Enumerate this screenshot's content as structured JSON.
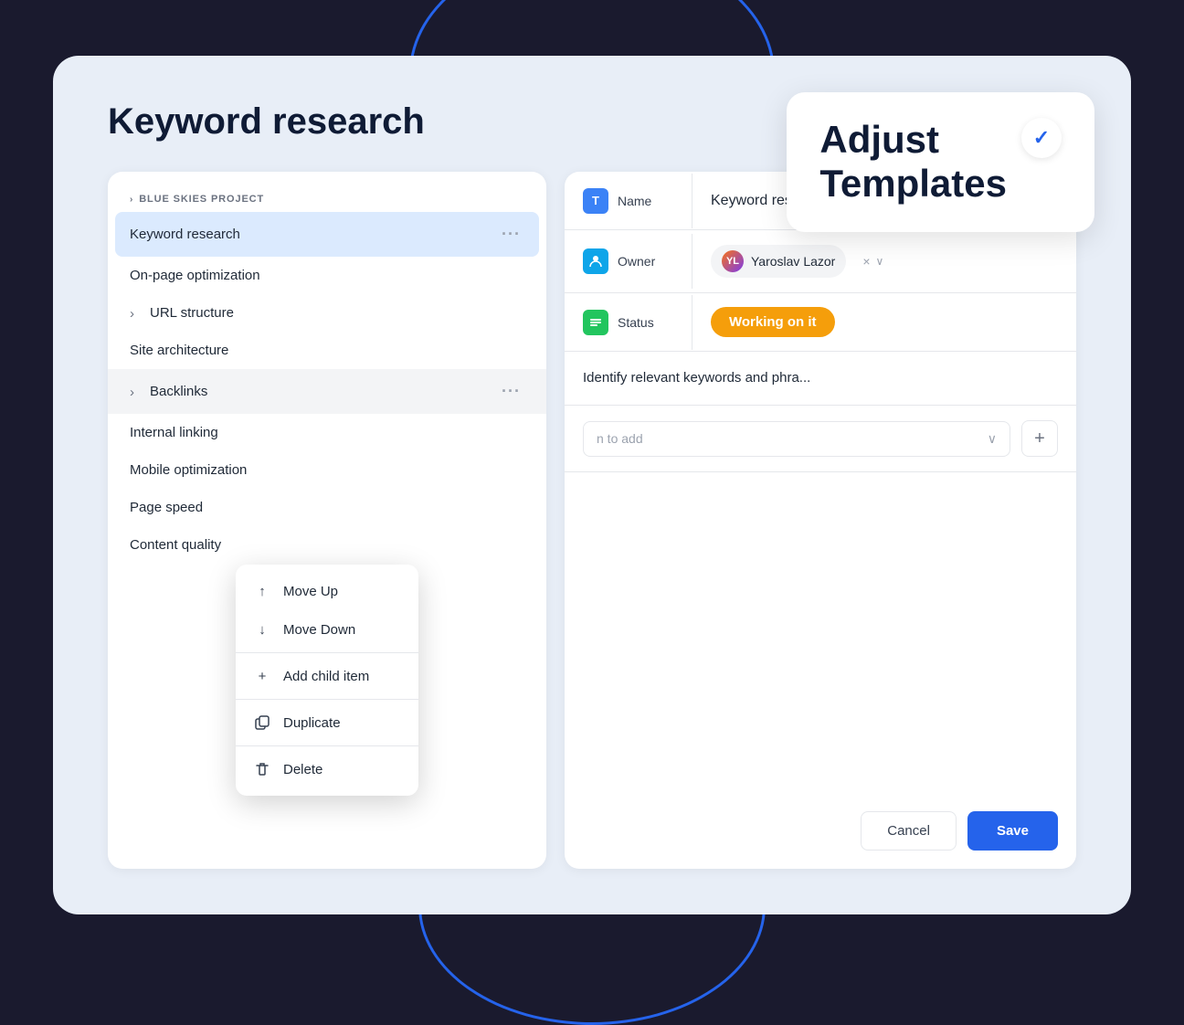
{
  "page": {
    "title": "Keyword research",
    "background_color": "#e8eef7"
  },
  "adjust_card": {
    "title_line1": "Adjust",
    "title_line2": "Templates",
    "check_symbol": "✓"
  },
  "project": {
    "label": "BLUE SKIES PROJECT"
  },
  "task_list": {
    "items": [
      {
        "id": "keyword-research",
        "label": "Keyword research",
        "indent": 0,
        "active": true,
        "has_menu": true
      },
      {
        "id": "on-page-optimization",
        "label": "On-page optimization",
        "indent": 0,
        "active": false,
        "has_menu": false
      },
      {
        "id": "url-structure",
        "label": "URL structure",
        "indent": 0,
        "active": false,
        "has_menu": false,
        "has_children": true
      },
      {
        "id": "site-architecture",
        "label": "Site architecture",
        "indent": 0,
        "active": false,
        "has_menu": false
      },
      {
        "id": "backlinks",
        "label": "Backlinks",
        "indent": 0,
        "active": false,
        "has_menu": true,
        "has_children": true,
        "context_open": true
      },
      {
        "id": "internal-linking",
        "label": "Internal linking",
        "indent": 0,
        "active": false,
        "has_menu": false
      },
      {
        "id": "mobile-optimization",
        "label": "Mobile optimization",
        "indent": 0,
        "active": false,
        "has_menu": false
      },
      {
        "id": "page-speed",
        "label": "Page speed",
        "indent": 0,
        "active": false,
        "has_menu": false
      },
      {
        "id": "content-quality",
        "label": "Content quality",
        "indent": 0,
        "active": false,
        "has_menu": false
      }
    ]
  },
  "context_menu": {
    "items": [
      {
        "id": "move-up",
        "label": "Move Up",
        "icon": "↑"
      },
      {
        "id": "move-down",
        "label": "Move Down",
        "icon": "↓"
      },
      {
        "id": "add-child",
        "label": "Add child item",
        "icon": "+"
      },
      {
        "id": "duplicate",
        "label": "Duplicate",
        "icon": "⧉"
      },
      {
        "id": "delete",
        "label": "Delete",
        "icon": "🗑"
      }
    ]
  },
  "detail_form": {
    "fields": [
      {
        "id": "name",
        "label": "Name",
        "icon_char": "T",
        "icon_color": "blue",
        "value": "Keyword research"
      },
      {
        "id": "owner",
        "label": "Owner",
        "icon_char": "👤",
        "icon_color": "teal",
        "owner_name": "Yaroslav Lazor"
      },
      {
        "id": "status",
        "label": "Status",
        "icon_char": "≡",
        "icon_color": "green",
        "status_label": "Working on it",
        "status_color": "#f59e0b"
      }
    ],
    "description_placeholder": "Identify relevant keywords and phra...",
    "person_placeholder": "n to add",
    "cancel_label": "Cancel",
    "save_label": "Save"
  }
}
